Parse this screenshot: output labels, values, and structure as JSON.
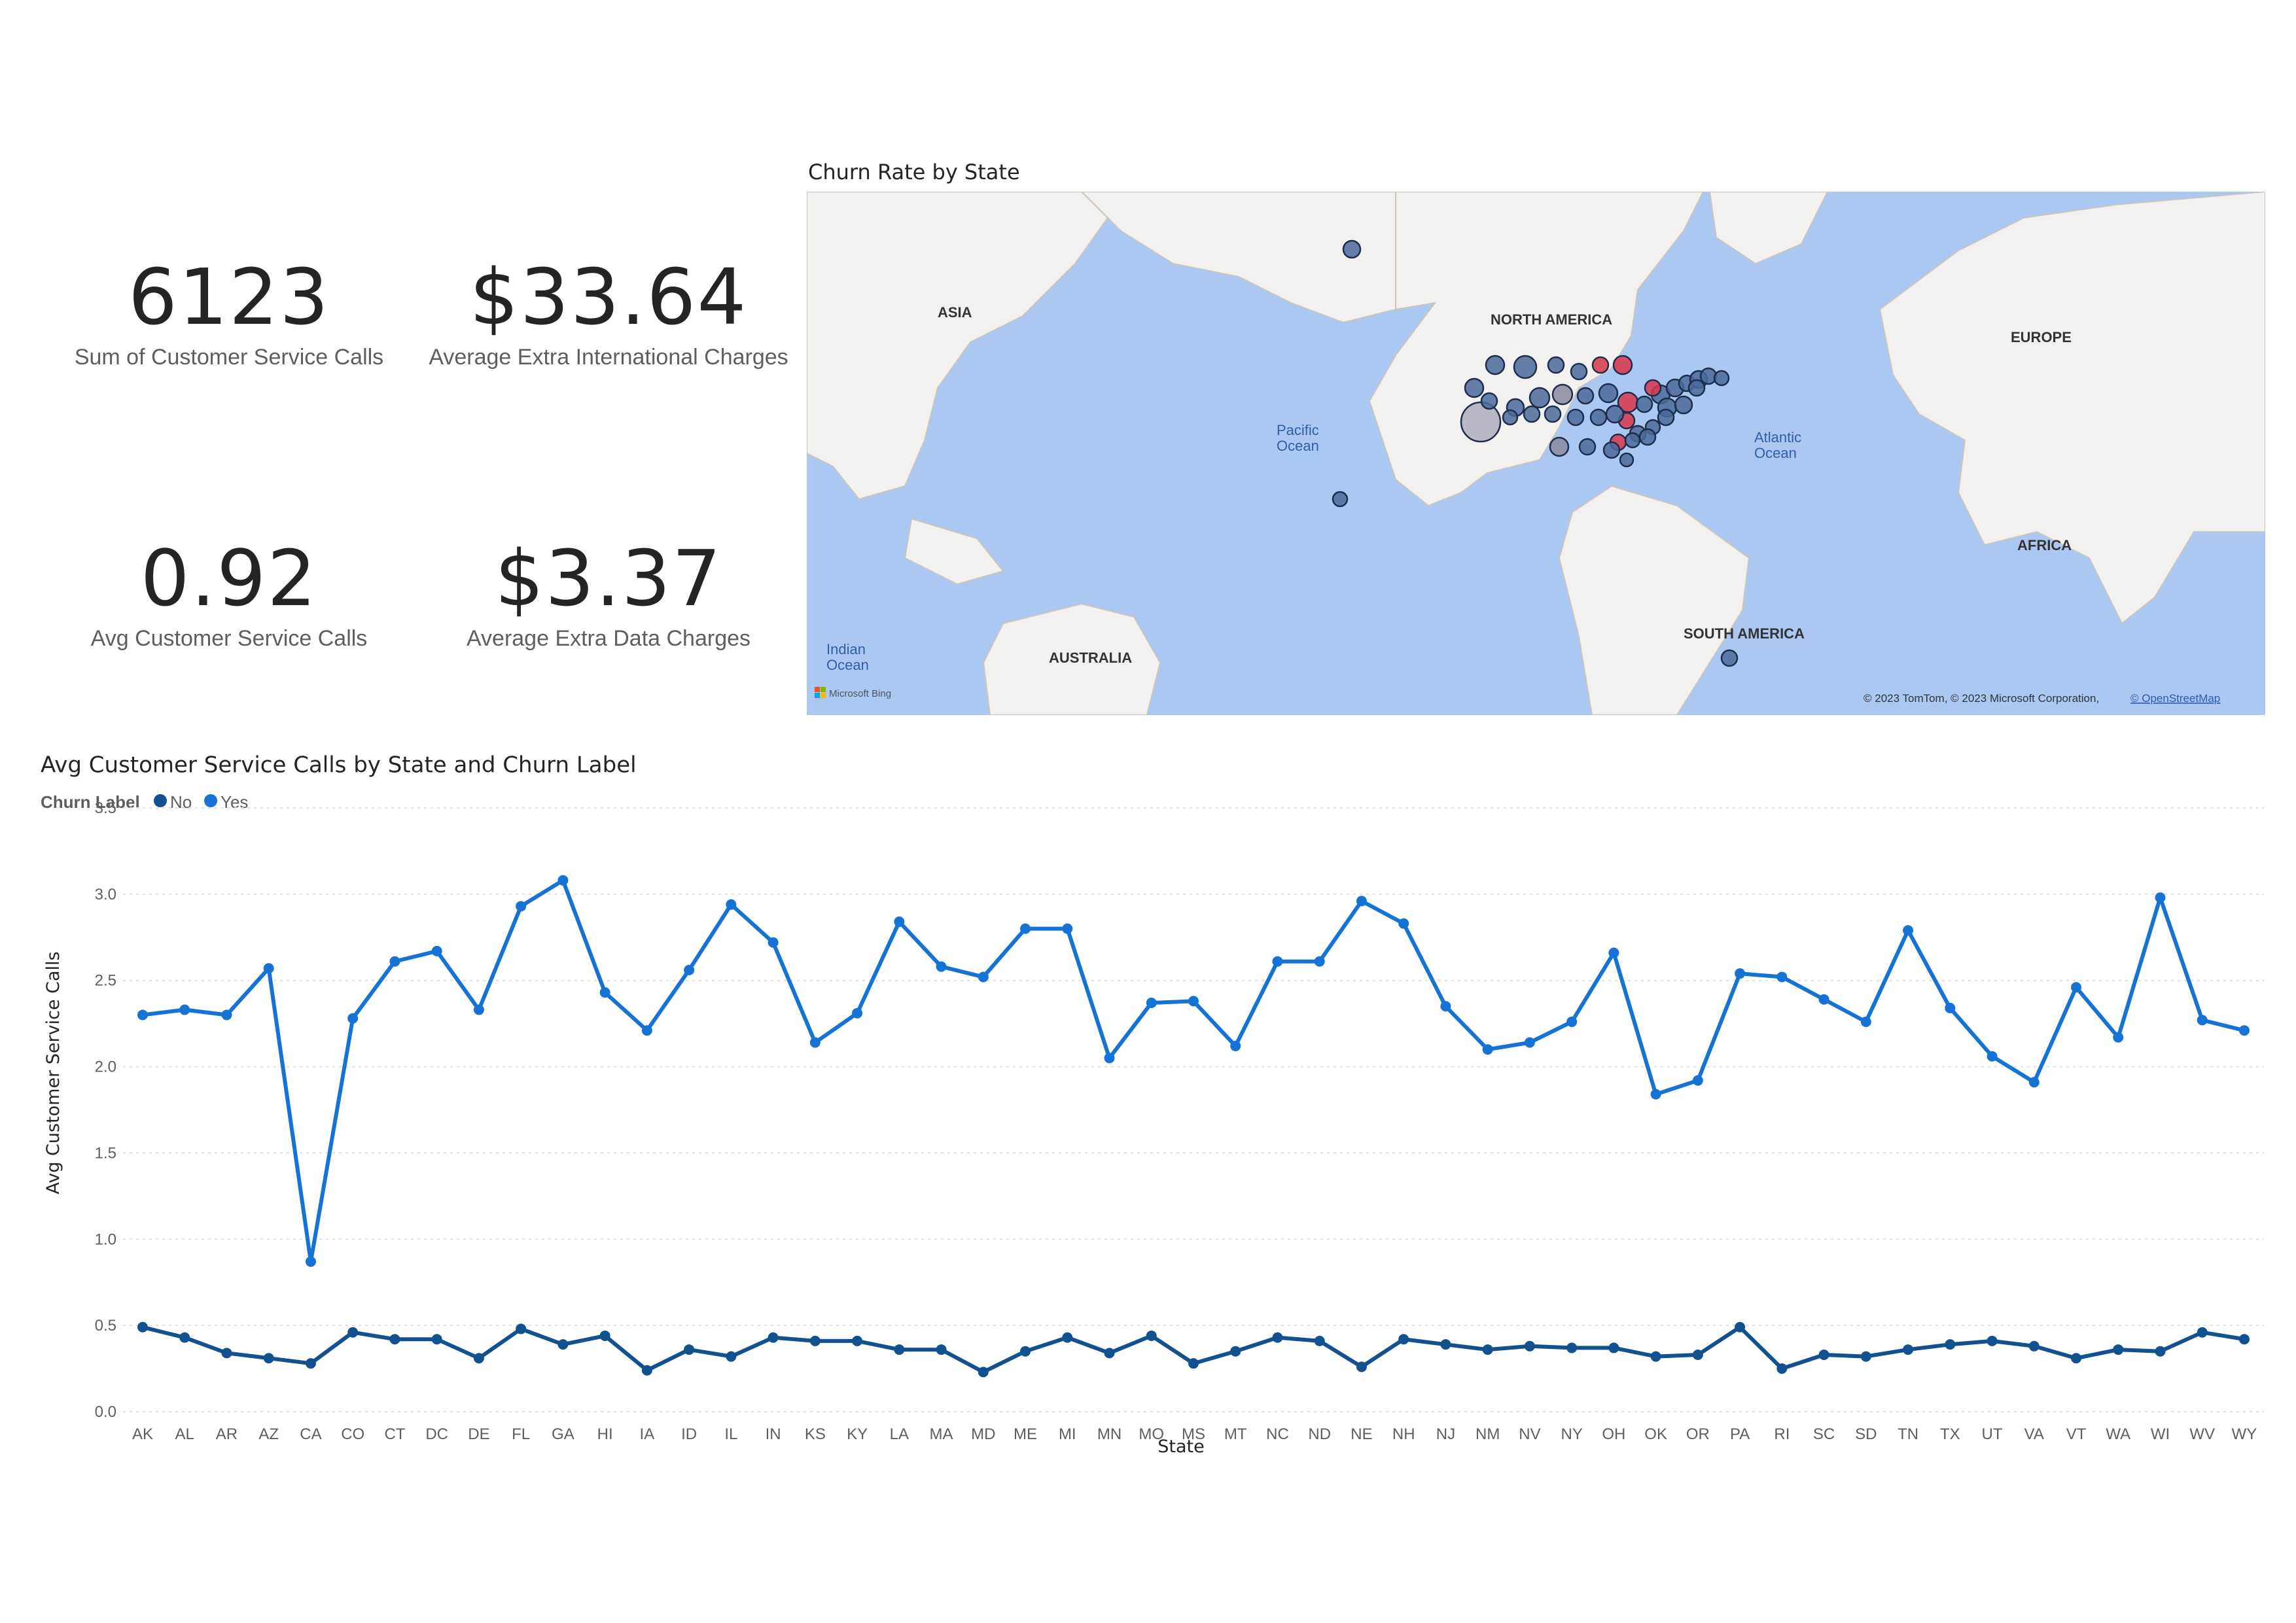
{
  "cards": [
    {
      "value": "6123",
      "label": "Sum of Customer Service Calls"
    },
    {
      "value": "$33.64",
      "label": "Average Extra International Charges"
    },
    {
      "value": "0.92",
      "label": "Avg Customer Service Calls"
    },
    {
      "value": "$3.37",
      "label": "Average Extra Data Charges"
    }
  ],
  "map": {
    "title": "Churn Rate by State",
    "labels": {
      "asia": "ASIA",
      "north_america": "NORTH AMERICA",
      "europe": "EUROPE",
      "africa": "AFRICA",
      "south_america": "SOUTH AMERICA",
      "australia": "AUSTRALIA",
      "pacific": "Pacific Ocean",
      "atlantic": "Atlantic Ocean",
      "indian": "Indian Ocean"
    },
    "logo": "Microsoft Bing",
    "attribution": "© 2023 TomTom, © 2023 Microsoft Corporation,",
    "attribution_link": "© OpenStreetMap",
    "colors": {
      "ocean": "#abc8f2",
      "land": "#f2f1ef",
      "bubble": "#4b6a9b",
      "bubble_high": "#d9364a"
    }
  },
  "line": {
    "title": "Avg Customer Service Calls by State and Churn Label",
    "legend_title": "Churn Label",
    "colors": {
      "No": "#12518f",
      "Yes": "#1673d6"
    }
  },
  "chart_data": {
    "type": "line",
    "title": "Avg Customer Service Calls by State and Churn Label",
    "xlabel": "State",
    "ylabel": "Avg Customer Service Calls",
    "ylim": [
      0,
      3.5
    ],
    "yticks": [
      "0.0",
      "0.5",
      "1.0",
      "1.5",
      "2.0",
      "2.5",
      "3.0",
      "3.5"
    ],
    "grid": true,
    "legend_placement": "top-left",
    "categories": [
      "AK",
      "AL",
      "AR",
      "AZ",
      "CA",
      "CO",
      "CT",
      "DC",
      "DE",
      "FL",
      "GA",
      "HI",
      "IA",
      "ID",
      "IL",
      "IN",
      "KS",
      "KY",
      "LA",
      "MA",
      "MD",
      "ME",
      "MI",
      "MN",
      "MO",
      "MS",
      "MT",
      "NC",
      "ND",
      "NE",
      "NH",
      "NJ",
      "NM",
      "NV",
      "NY",
      "OH",
      "OK",
      "OR",
      "PA",
      "RI",
      "SC",
      "SD",
      "TN",
      "TX",
      "UT",
      "VA",
      "VT",
      "WA",
      "WI",
      "WV",
      "WY"
    ],
    "series": [
      {
        "name": "No",
        "values": [
          0.49,
          0.43,
          0.34,
          0.31,
          0.28,
          0.46,
          0.42,
          0.42,
          0.31,
          0.48,
          0.39,
          0.44,
          0.24,
          0.36,
          0.32,
          0.43,
          0.41,
          0.41,
          0.36,
          0.36,
          0.23,
          0.35,
          0.43,
          0.34,
          0.44,
          0.28,
          0.35,
          0.43,
          0.41,
          0.26,
          0.42,
          0.39,
          0.36,
          0.38,
          0.37,
          0.37,
          0.32,
          0.33,
          0.49,
          0.25,
          0.33,
          0.32,
          0.36,
          0.39,
          0.41,
          0.38,
          0.31,
          0.36,
          0.35,
          0.46,
          0.42
        ]
      },
      {
        "name": "Yes",
        "values": [
          2.3,
          2.33,
          2.3,
          2.57,
          0.87,
          2.28,
          2.61,
          2.67,
          2.33,
          2.93,
          3.08,
          2.43,
          2.21,
          2.56,
          2.94,
          2.72,
          2.14,
          2.31,
          2.84,
          2.58,
          2.52,
          2.8,
          2.8,
          2.05,
          2.37,
          2.38,
          2.12,
          2.61,
          2.61,
          2.96,
          2.83,
          2.35,
          2.1,
          2.14,
          2.26,
          2.66,
          1.84,
          1.92,
          2.54,
          2.52,
          2.39,
          2.26,
          2.79,
          2.34,
          2.06,
          1.91,
          2.46,
          2.17,
          2.98,
          2.27,
          2.21
        ]
      }
    ]
  }
}
